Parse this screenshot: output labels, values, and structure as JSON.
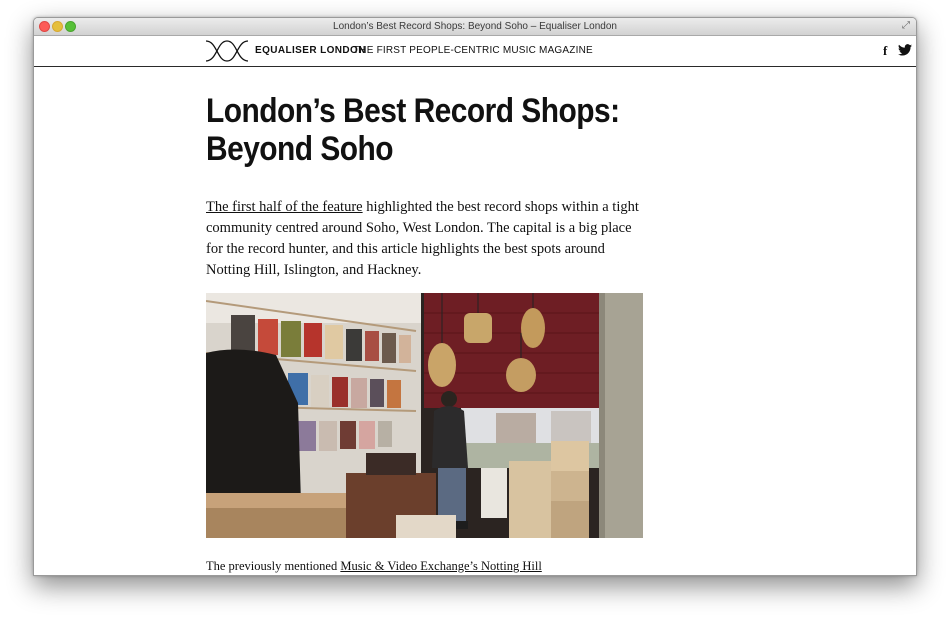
{
  "window": {
    "title": "London’s Best Record Shops: Beyond Soho – Equaliser London"
  },
  "header": {
    "site_name": "EQUALISER LONDON",
    "tagline": "THE FIRST PEOPLE-CENTRIC MUSIC MAGAZINE",
    "social": {
      "facebook_glyph": "f",
      "facebook_icon": "facebook-icon",
      "twitter_icon": "twitter-icon"
    }
  },
  "article": {
    "title_line1": "London’s Best Record Shops:",
    "title_line2": "Beyond Soho",
    "intro_link": "The first half of the feature",
    "intro_text": " highlighted the best record shops within a tight community centred around Soho, West London. The capital is a big place for the record hunter, and this article highlights the best spots around Notting Hill, Islington, and Hackney.",
    "photo_icon": "record-shop-photo",
    "next_text": "The previously mentioned ",
    "next_link": "Music & Video Exchange’s Notting Hill"
  },
  "colors": {
    "text": "#111111",
    "header_rule": "#2a2a2a",
    "window_border": "#9a9a9a"
  }
}
